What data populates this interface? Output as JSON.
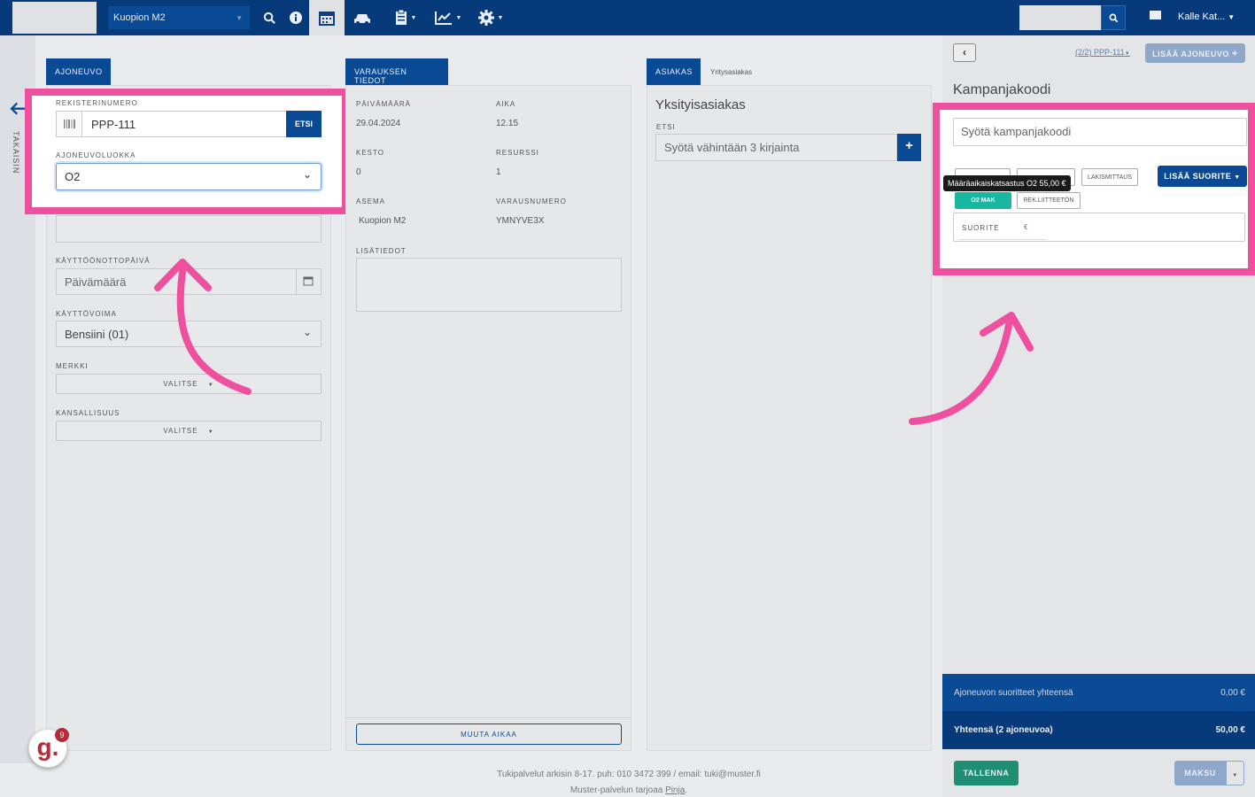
{
  "topbar": {
    "station": "Kuopion M2",
    "user_name": "Kalle Kat..."
  },
  "back": {
    "label": "TAKAISIN"
  },
  "vehicle": {
    "tab": "AJONEUVO",
    "reg_label": "REKISTERINUMERO",
    "reg_value": "PPP-111",
    "search_button": "ETSI",
    "class_label": "AJONEUVOLUOKKA",
    "class_value": "O2",
    "commission_label": "KÄYTTÖÖNOTTOPÄIVÄ",
    "commission_placeholder": "Päivämäärä",
    "fuel_label": "KÄYTTÖVOIMA",
    "fuel_value": "Bensiini (01)",
    "make_label": "MERKKI",
    "make_value": "VALITSE",
    "nationality_label": "KANSALLISUUS",
    "nationality_value": "VALITSE"
  },
  "reservation": {
    "tab": "VARAUKSEN TIEDOT",
    "date_label": "PÄIVÄMÄÄRÄ",
    "date_value": "29.04.2024",
    "time_label": "AIKA",
    "time_value": "12.15",
    "duration_label": "KESTO",
    "duration_value": "0",
    "resource_label": "RESURSSI",
    "resource_value": "1",
    "station_label": "ASEMA",
    "station_value": "Kuopion M2",
    "number_label": "VARAUSNUMERO",
    "number_value": "YMNYVE3X",
    "extra_label": "LISÄTIEDOT",
    "change_time_button": "MUUTA AIKAA"
  },
  "customer": {
    "tab_active": "ASIAKAS",
    "tab_other": "Yritysasiakas",
    "title": "Yksityisasiakas",
    "search_label": "ETSI",
    "search_placeholder": "Syötä vähintään 3 kirjainta"
  },
  "right": {
    "vehicle_nav": "(2/2) PPP-111",
    "add_vehicle_button": "LISÄÄ AJONEUVO",
    "campaign_title": "Kampanjakoodi",
    "campaign_placeholder": "Syötä kampanjakoodi",
    "tooltip": "Määräaikaiskatsastus O2 55,00 €",
    "chip_lakismittaus": "LAKISMITTAUS",
    "chip_o2mak": "O2 MAK",
    "chip_rek": "REK.LIITTEETÖN",
    "add_service_button": "LISÄÄ SUORITE",
    "service_label": "SUORITE",
    "service_currency": "€",
    "total_vehicle_label": "Ajoneuvon suoritteet yhteensä",
    "total_vehicle_value": "0,00 €",
    "total_label": "Yhteensä (2 ajoneuvoa)",
    "total_value": "50,00 €",
    "save_button": "TALLENNA",
    "pay_button": "MAKSU"
  },
  "footer": {
    "line1": "Tukipalvelut arkisin 8-17. puh: 010 3472 399 / email: tuki@muster.fi",
    "line2_prefix": "Muster-palvelun tarjoaa ",
    "line2_link": "Pinja",
    "line2_suffix": "."
  },
  "badge": {
    "letter": "g.",
    "count": "9"
  },
  "colors": {
    "accent": "#0a4a94",
    "highlight": "#ee4f9f",
    "teal": "#19b7a0",
    "green": "#1e8f73"
  }
}
